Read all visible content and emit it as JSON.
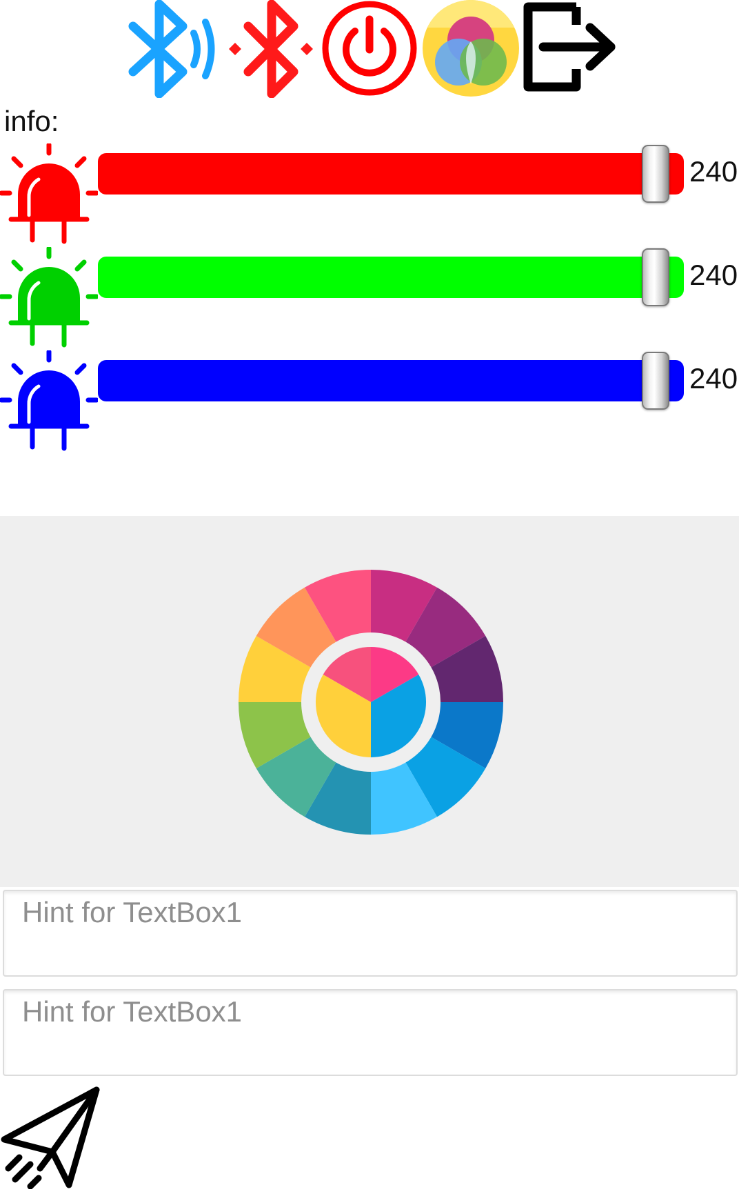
{
  "toolbar": {
    "icons": [
      "bluetooth-searching-icon",
      "bluetooth-disconnect-icon",
      "power-icon",
      "color-mixer-icon",
      "logout-icon"
    ]
  },
  "info": {
    "label": "info:"
  },
  "sliders": [
    {
      "channel": "red",
      "color": "#ff0000",
      "led_color": "#ff0000",
      "value": "240",
      "level": 0.94
    },
    {
      "channel": "green",
      "color": "#00ff00",
      "led_color": "#00d000",
      "value": "240",
      "level": 0.94
    },
    {
      "channel": "blue",
      "color": "#0000ff",
      "led_color": "#0000ff",
      "value": "240",
      "level": 0.94
    }
  ],
  "colors": {
    "bluetooth": "#1aa3ff",
    "disconnect": "#ff1a1a",
    "power": "#ff0000",
    "panel_bg": "#efefef"
  },
  "color_wheel": {
    "icon": "color-wheel-icon"
  },
  "inputs": [
    {
      "placeholder": "Hint for TextBox1",
      "value": ""
    },
    {
      "placeholder": "Hint for TextBox1",
      "value": ""
    }
  ],
  "send_button": {
    "icon": "paper-plane-send-icon"
  }
}
